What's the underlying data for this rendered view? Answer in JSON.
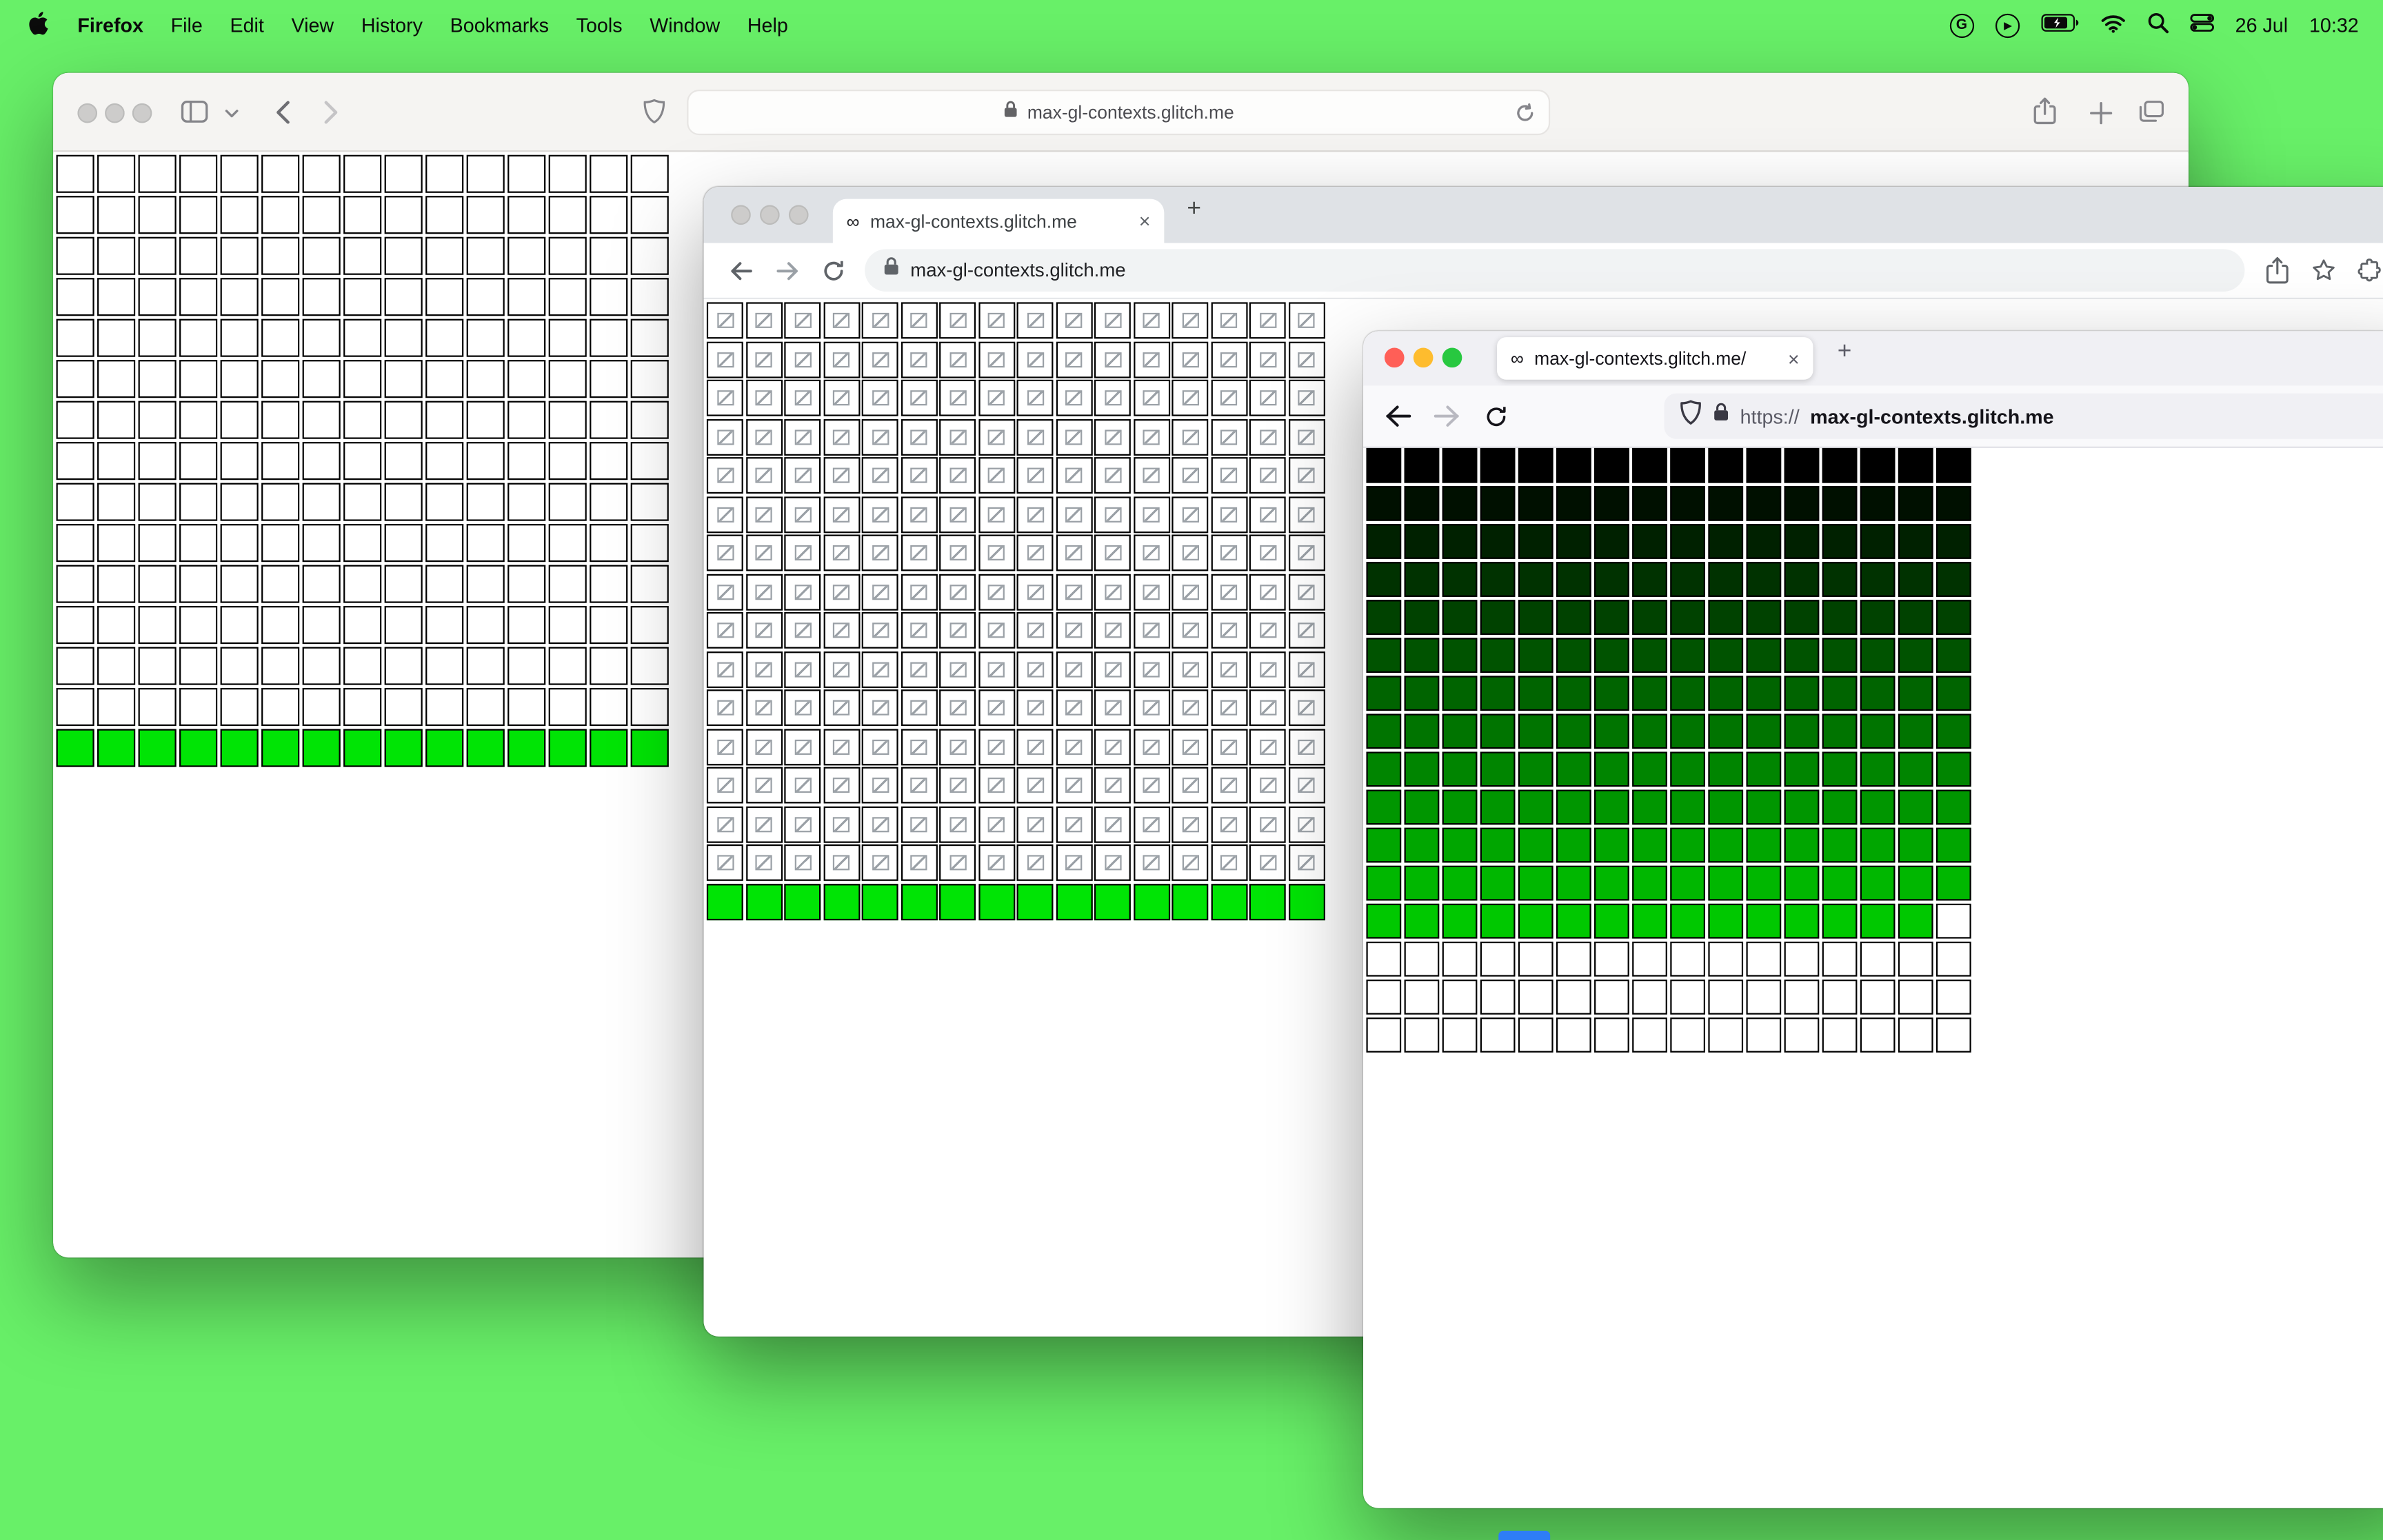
{
  "desktop": {
    "background": "#68f068"
  },
  "traffic_lights": {
    "red": "#ff5f57",
    "yellow": "#febc2e",
    "green": "#28c840",
    "inactive": "#cdcccb"
  },
  "menubar": {
    "app_name": "Firefox",
    "items": [
      "File",
      "Edit",
      "View",
      "History",
      "Bookmarks",
      "Tools",
      "Window",
      "Help"
    ],
    "date": "26 Jul",
    "time": "10:32"
  },
  "glyphs": {
    "infinity": "∞",
    "close": "×",
    "plus": "+",
    "g_badge": "G",
    "play_badge": "▶"
  },
  "safari": {
    "url": "max-gl-contexts.glitch.me",
    "grid": {
      "cols": 15,
      "empty_rows": 14,
      "green_rows": 1,
      "empty_color": "#ffffff",
      "green_color": "#00e405",
      "border": "#000000"
    }
  },
  "chrome": {
    "tab_title": "max-gl-contexts.glitch.me",
    "url": "max-gl-contexts.glitch.me",
    "grid": {
      "cols": 16,
      "broken_rows": 15,
      "green_rows": 1,
      "cell_color": "#ffffff",
      "green_color": "#00e405",
      "border": "#000000"
    }
  },
  "firefox": {
    "tab_title": "max-gl-contexts.glitch.me/",
    "url_scheme": "https://",
    "url_host": "max-gl-contexts.glitch.me",
    "grid": {
      "cols": 16,
      "row_colors": [
        "#000000",
        "#001000",
        "#002100",
        "#003200",
        "#004200",
        "#005300",
        "#006400",
        "#007400",
        "#008500",
        "#009600",
        "#00a600",
        "#00b700",
        "#00c800"
      ],
      "trailing_white_cells": 1,
      "empty_rows": 3,
      "empty_color": "#ffffff",
      "border": "#000000"
    }
  }
}
